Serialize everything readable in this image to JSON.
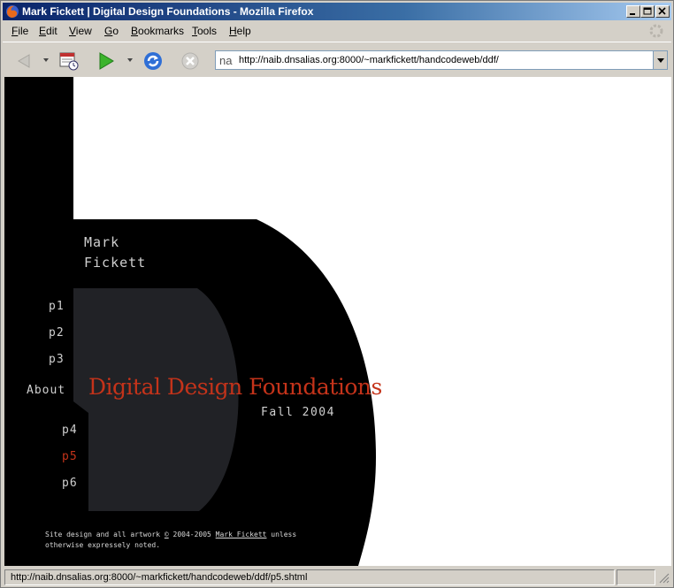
{
  "window": {
    "title": "Mark Fickett | Digital Design Foundations - Mozilla Firefox"
  },
  "menu": {
    "items": [
      {
        "key": "F",
        "rest": "ile"
      },
      {
        "key": "E",
        "rest": "dit"
      },
      {
        "key": "V",
        "rest": "iew"
      },
      {
        "key": "G",
        "rest": "o"
      },
      {
        "key": "B",
        "rest": "ookmarks"
      },
      {
        "key": "T",
        "rest": "ools"
      },
      {
        "key": "H",
        "rest": "elp"
      }
    ]
  },
  "toolbar": {
    "url": "http://naib.dnsalias.org:8000/~markfickett/handcodeweb/ddf/",
    "favicon_text": "na"
  },
  "page": {
    "author_first": "Mark",
    "author_last": "Fickett",
    "nav": [
      "p1",
      "p2",
      "p3",
      "About",
      "p4",
      "p5",
      "p6"
    ],
    "active_nav": "p5",
    "heading": "Digital Design Foundations",
    "semester": "Fall 2004",
    "footer_prefix": "Site design and all artwork ",
    "footer_copyright": "©",
    "footer_years": " 2004-2005 ",
    "footer_author": "Mark Fickett",
    "footer_suffix": " unless otherwise expressely noted.",
    "colors": {
      "background": "#000000",
      "panel": "#212226",
      "accent": "#c4331a",
      "text": "#d0d0d0"
    }
  },
  "status": {
    "text": "http://naib.dnsalias.org:8000/~markfickett/handcodeweb/ddf/p5.shtml"
  }
}
